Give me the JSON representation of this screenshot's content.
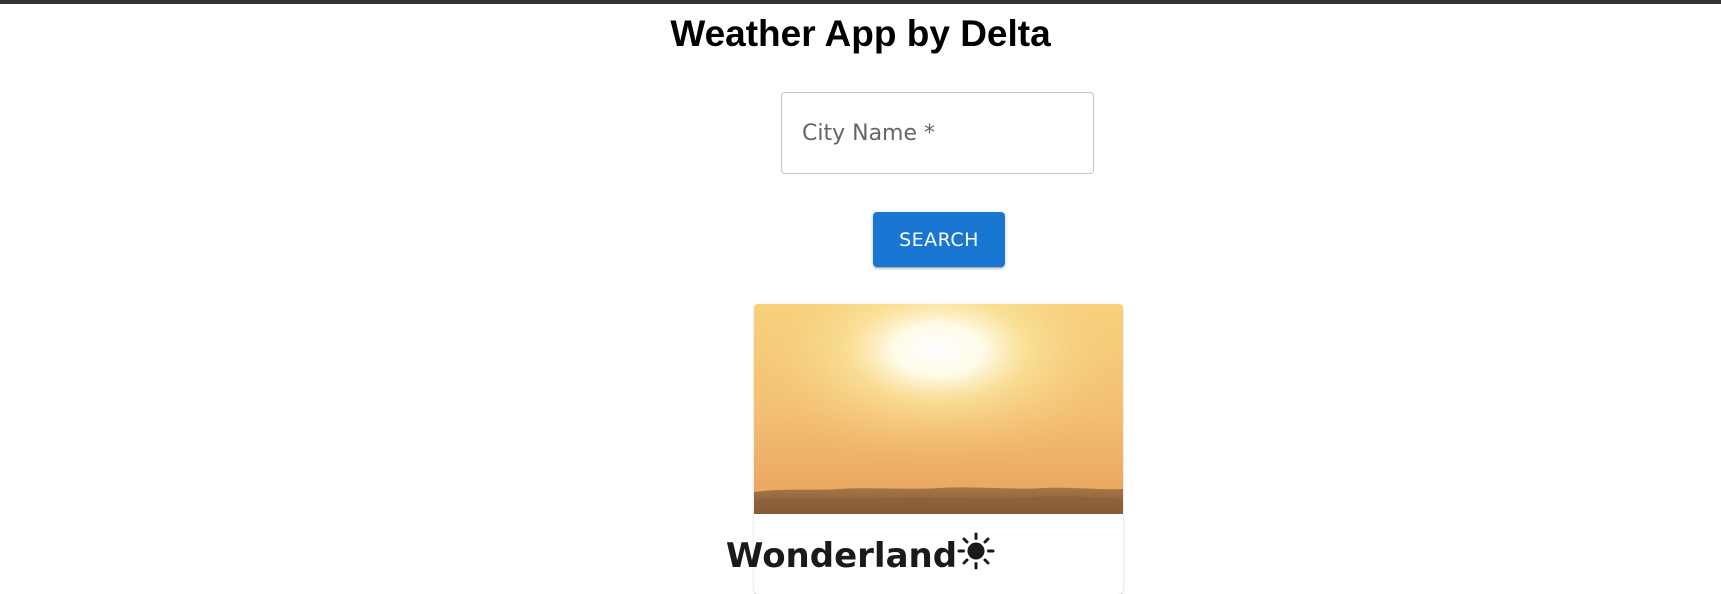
{
  "app": {
    "title": "Weather App by Delta"
  },
  "search": {
    "placeholder": "City Name *",
    "value": "",
    "button_label": "SEARCH"
  },
  "card": {
    "city": "Wonderland",
    "weather_icon": "sun-icon",
    "image": "desert-sunset-image"
  },
  "colors": {
    "accent": "#1976d2",
    "top_bar": "#333333"
  }
}
